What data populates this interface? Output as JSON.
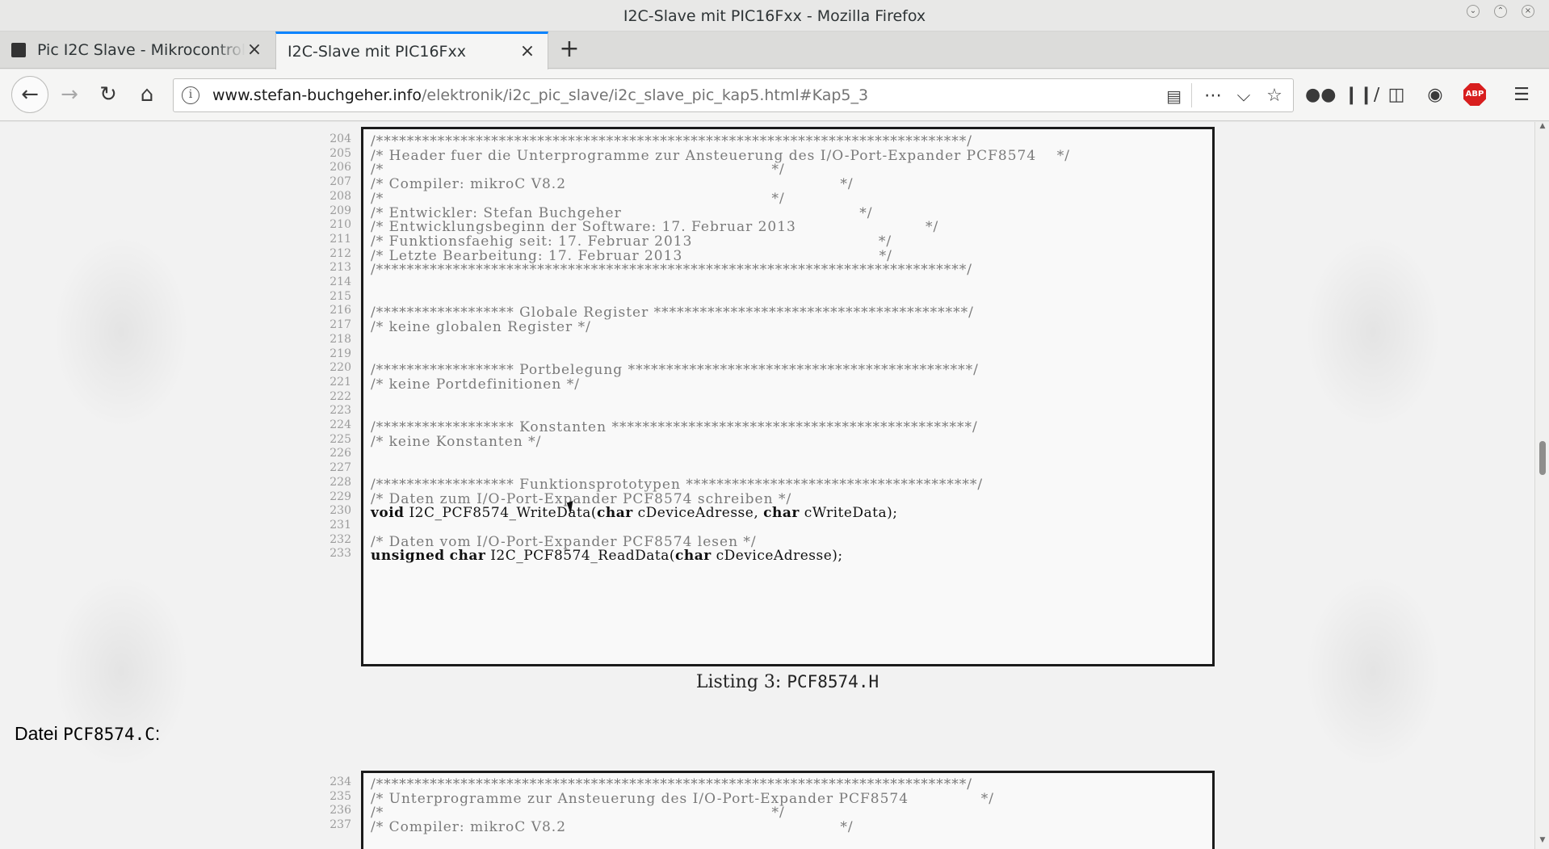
{
  "window": {
    "title": "I2C-Slave mit PIC16Fxx - Mozilla Firefox"
  },
  "tabs": [
    {
      "label": "Pic I2C Slave - Mikrocontroller",
      "active": false
    },
    {
      "label": "I2C-Slave mit PIC16Fxx",
      "active": true
    }
  ],
  "navbar": {
    "url_host": "www.stefan-buchgeher.info",
    "url_path": "/elektronik/i2c_pic_slave/i2c_slave_pic_kap5.html#Kap5_3",
    "abp_label": "ABP"
  },
  "icons": {
    "back": "back-arrow-icon",
    "forward": "forward-arrow-icon",
    "reload": "reload-icon",
    "home": "home-icon",
    "info": "info-icon",
    "reader": "reader-view-icon",
    "more": "more-dots-icon",
    "pocket": "pocket-icon",
    "bookmark": "star-icon",
    "mask": "mask-icon",
    "library": "library-icon",
    "sidebar": "sidebar-icon",
    "extension": "extension-icon",
    "adblock": "adblock-plus-icon",
    "menu": "hamburger-menu-icon"
  },
  "listing1": {
    "lines": [
      {
        "no": "204",
        "text": "/*****************************************************************************/",
        "code": false
      },
      {
        "no": "205",
        "text": "/* Header fuer die Unterprogramme zur Ansteuerung des I/O-Port-Expander PCF8574    */",
        "code": false
      },
      {
        "no": "206",
        "text": "/*                                                                           */",
        "code": false
      },
      {
        "no": "207",
        "text": "/* Compiler: mikroC V8.2                                                     */",
        "code": false
      },
      {
        "no": "208",
        "text": "/*                                                                           */",
        "code": false
      },
      {
        "no": "209",
        "text": "/* Entwickler: Stefan Buchgeher                                              */",
        "code": false
      },
      {
        "no": "210",
        "text": "/* Entwicklungsbeginn der Software: 17. Februar 2013                         */",
        "code": false
      },
      {
        "no": "211",
        "text": "/* Funktionsfaehig seit: 17. Februar 2013                                    */",
        "code": false
      },
      {
        "no": "212",
        "text": "/* Letzte Bearbeitung: 17. Februar 2013                                      */",
        "code": false
      },
      {
        "no": "213",
        "text": "/*****************************************************************************/",
        "code": false
      },
      {
        "no": "214",
        "text": "",
        "code": false
      },
      {
        "no": "215",
        "text": "",
        "code": false
      },
      {
        "no": "216",
        "text": "/****************** Globale Register *****************************************/",
        "code": false
      },
      {
        "no": "217",
        "text": "/* keine globalen Register */",
        "code": false
      },
      {
        "no": "218",
        "text": "",
        "code": false
      },
      {
        "no": "219",
        "text": "",
        "code": false
      },
      {
        "no": "220",
        "text": "/****************** Portbelegung *********************************************/",
        "code": false
      },
      {
        "no": "221",
        "text": "/* keine Portdefinitionen */",
        "code": false
      },
      {
        "no": "222",
        "text": "",
        "code": false
      },
      {
        "no": "223",
        "text": "",
        "code": false
      },
      {
        "no": "224",
        "text": "/****************** Konstanten ***********************************************/",
        "code": false
      },
      {
        "no": "225",
        "text": "/* keine Konstanten */",
        "code": false
      },
      {
        "no": "226",
        "text": "",
        "code": false
      },
      {
        "no": "227",
        "text": "",
        "code": false
      },
      {
        "no": "228",
        "text": "/****************** Funktionsprototypen **************************************/",
        "code": false
      },
      {
        "no": "229",
        "text": "/* Daten zum I/O-Port-Expander PCF8574 schreiben */",
        "code": false
      },
      {
        "no": "230",
        "text": "void I2C_PCF8574_WriteData(char cDeviceAdresse, char cWriteData);",
        "code": true
      },
      {
        "no": "231",
        "text": "",
        "code": false
      },
      {
        "no": "232",
        "text": "/* Daten vom I/O-Port-Expander PCF8574 lesen */",
        "code": false
      },
      {
        "no": "233",
        "text": "unsigned char I2C_PCF8574_ReadData(char cDeviceAdresse);",
        "code": true
      }
    ]
  },
  "caption": {
    "prefix": "Listing 3: ",
    "file": "PCF8574.H"
  },
  "file_heading": {
    "prefix": "Datei ",
    "file": "PCF8574.C",
    "suffix": ":"
  },
  "listing2": {
    "lines": [
      {
        "no": "234",
        "text": "/*****************************************************************************/",
        "code": false
      },
      {
        "no": "235",
        "text": "/* Unterprogramme zur Ansteuerung des I/O-Port-Expander PCF8574              */",
        "code": false
      },
      {
        "no": "236",
        "text": "/*                                                                           */",
        "code": false
      },
      {
        "no": "237",
        "text": "/* Compiler: mikroC V8.2                                                     */",
        "code": false
      }
    ]
  }
}
